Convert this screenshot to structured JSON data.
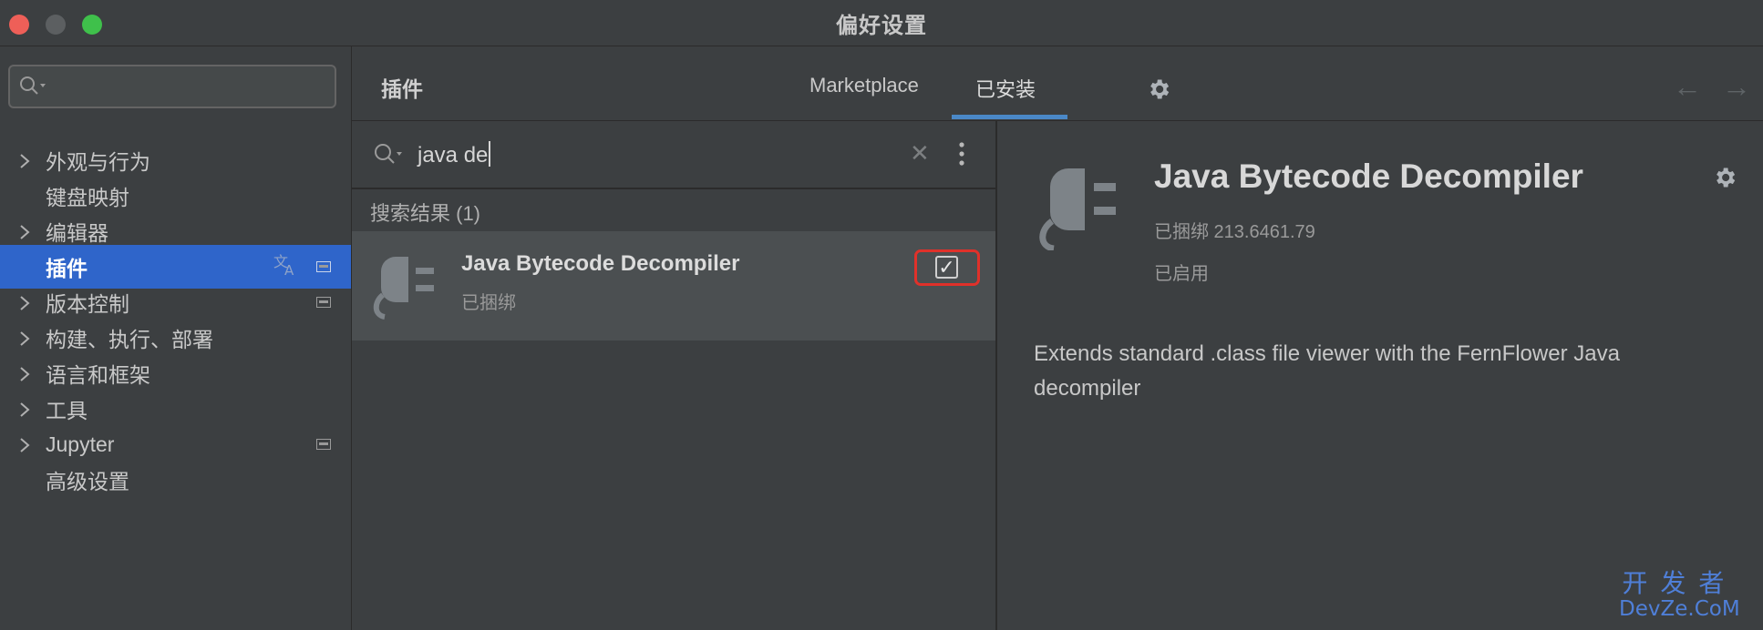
{
  "window": {
    "title": "偏好设置",
    "controls": [
      "close-icon",
      "minimize-icon",
      "maximize-icon"
    ]
  },
  "sidebar": {
    "search": {
      "placeholder": "",
      "icon": "search-icon"
    },
    "items": [
      {
        "label": "外观与行为",
        "expandable": true
      },
      {
        "label": "键盘映射",
        "expandable": false
      },
      {
        "label": "编辑器",
        "expandable": true
      },
      {
        "label": "插件",
        "expandable": false,
        "active": true,
        "icons": [
          "translate-icon",
          "project-level-icon"
        ]
      },
      {
        "label": "版本控制",
        "expandable": true,
        "icons": [
          "project-level-icon"
        ]
      },
      {
        "label": "构建、执行、部署",
        "expandable": true
      },
      {
        "label": "语言和框架",
        "expandable": true
      },
      {
        "label": "工具",
        "expandable": true
      },
      {
        "label": "Jupyter",
        "expandable": true,
        "icons": [
          "project-level-icon"
        ]
      },
      {
        "label": "高级设置",
        "expandable": false
      }
    ]
  },
  "header": {
    "breadcrumb": "插件",
    "tabs": [
      {
        "label": "Marketplace",
        "selected": false
      },
      {
        "label": "已安装",
        "selected": true
      }
    ],
    "icons": [
      "gear-icon",
      "arrow-left-icon",
      "arrow-right-icon"
    ]
  },
  "plugin_list": {
    "search_value": "java de",
    "results_label": "搜索结果 (1)",
    "items": [
      {
        "name": "Java Bytecode Decompiler",
        "status": "已捆绑",
        "enabled": true,
        "icon": "plugin-plug-icon"
      }
    ]
  },
  "detail": {
    "name": "Java Bytecode Decompiler",
    "version": "已捆绑 213.6461.79",
    "state": "已启用",
    "description": "Extends standard .class file viewer with the FernFlower Java decompiler"
  },
  "watermark": {
    "line1": "开发者",
    "line2": "DevZe.CoM"
  },
  "colors": {
    "accent": "#2f65ca",
    "tab_underline": "#4a88c7",
    "highlight_box": "#e0312a",
    "watermark": "#4f7fd8"
  }
}
